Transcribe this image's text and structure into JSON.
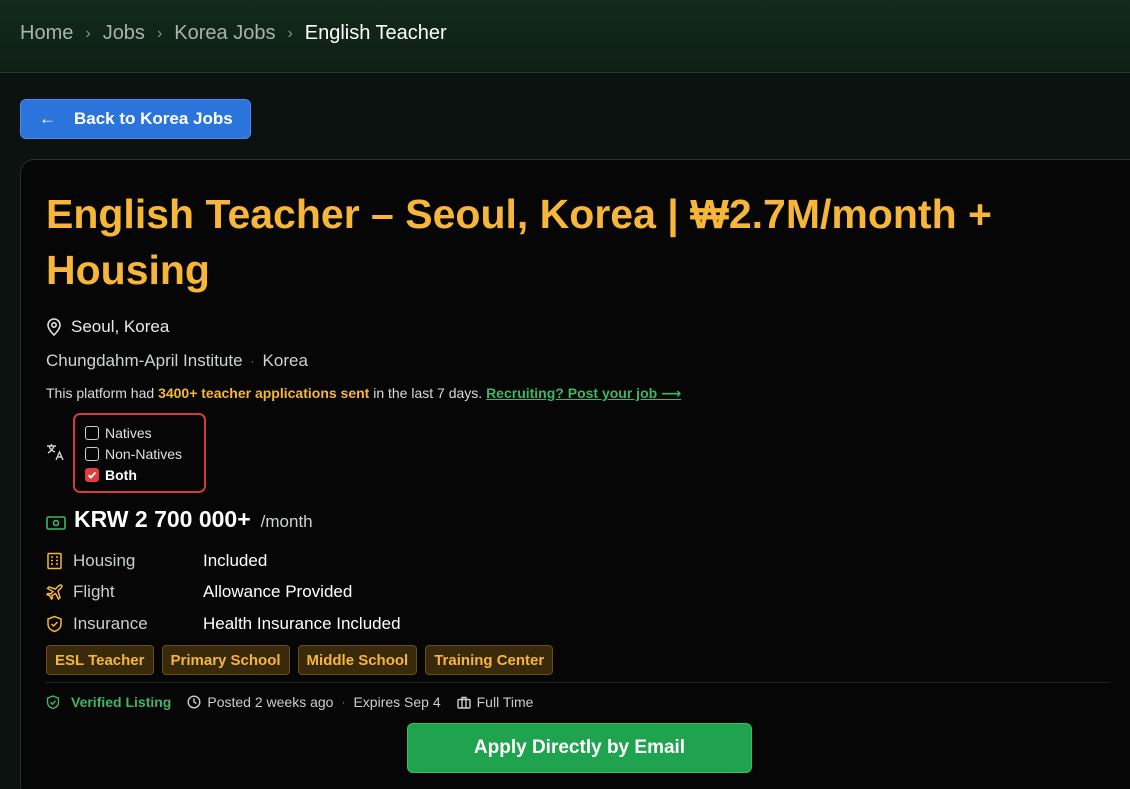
{
  "breadcrumb": {
    "home": "Home",
    "jobs": "Jobs",
    "korea_jobs": "Korea Jobs",
    "current": "English Teacher"
  },
  "back_button": {
    "label": "Back to Korea Jobs"
  },
  "job": {
    "title": "English Teacher – Seoul, Korea | ₩2.7M/month + Housing",
    "location": "Seoul, Korea",
    "company": "Chungdahm-April Institute",
    "country": "Korea"
  },
  "platform": {
    "prefix": "This platform had ",
    "highlight": "3400+ teacher applications sent",
    "suffix": " in the last 7 days. ",
    "link": "Recruiting? Post your job ⟶"
  },
  "language_options": [
    {
      "label": "Natives",
      "checked": false
    },
    {
      "label": "Non-Natives",
      "checked": false
    },
    {
      "label": "Both",
      "checked": true
    }
  ],
  "salary": {
    "amount": "KRW 2 700 000+",
    "period": "/month"
  },
  "benefits": {
    "housing": {
      "label": "Housing",
      "value": "Included"
    },
    "flight": {
      "label": "Flight",
      "value": "Allowance Provided"
    },
    "insurance": {
      "label": "Insurance",
      "value": "Health Insurance Included"
    }
  },
  "tags": [
    "ESL Teacher",
    "Primary School",
    "Middle School",
    "Training Center"
  ],
  "meta": {
    "verified": "Verified Listing",
    "posted": "Posted 2 weeks ago",
    "expires": "Expires Sep 4",
    "type": "Full Time"
  },
  "apply_button": {
    "label": "Apply Directly by Email"
  },
  "colors": {
    "accent": "#f6b63a",
    "link_green": "#3fb567",
    "button_blue": "#2b74dc",
    "button_green": "#1fa34e",
    "highlight_red": "#d33a3a"
  }
}
